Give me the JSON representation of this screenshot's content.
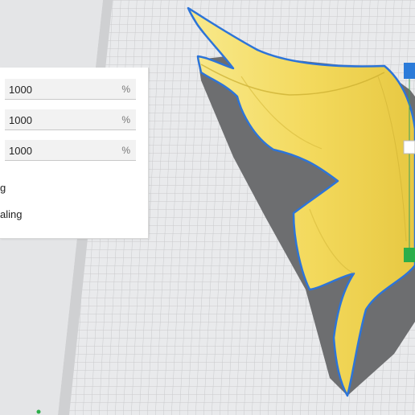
{
  "scale_panel": {
    "fields": [
      {
        "value": "1000",
        "unit": "%"
      },
      {
        "value": "1000",
        "unit": "%"
      },
      {
        "value": "1000",
        "unit": "%"
      }
    ],
    "options": [
      {
        "label": "g"
      },
      {
        "label": "aling"
      }
    ]
  },
  "colors": {
    "build_plate": "#e9eaec",
    "grid_line": "#c9cacc",
    "model": "#f7e27a",
    "model_outline": "#2d74d8",
    "shadow": "#6d6e70",
    "handle_blue": "#2b7bd9",
    "handle_green": "#2bae4a"
  },
  "icons": [
    "scale-handle-blue-icon",
    "scale-handle-white-icon",
    "scale-handle-green-icon"
  ]
}
